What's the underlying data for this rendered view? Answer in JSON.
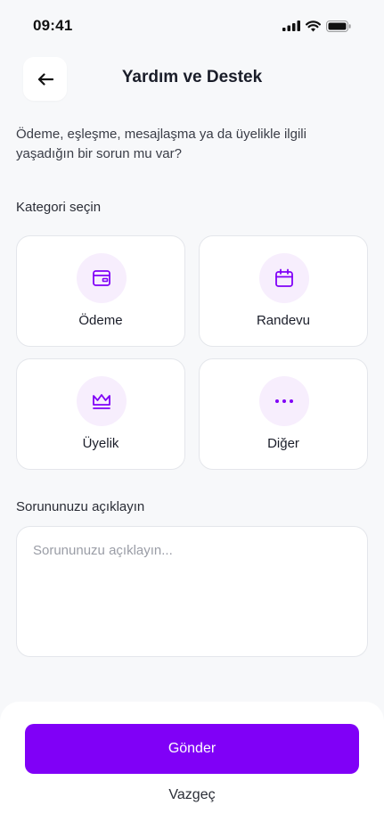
{
  "status_bar": {
    "time": "09:41"
  },
  "header": {
    "title": "Yardım ve Destek",
    "back_icon": "arrow-left-icon"
  },
  "intro": {
    "text": "Ödeme, eşleşme, mesajlaşma ya da üyelikle ilgili yaşadığın bir sorun mu var?"
  },
  "categories": {
    "label": "Kategori seçin",
    "items": [
      {
        "label": "Ödeme",
        "icon": "wallet-icon"
      },
      {
        "label": "Randevu",
        "icon": "calendar-icon"
      },
      {
        "label": "Üyelik",
        "icon": "crown-icon"
      },
      {
        "label": "Diğer",
        "icon": "more-dots-icon"
      }
    ]
  },
  "description": {
    "label": "Sorununuzu açıklayın",
    "placeholder": "Sorununuzu açıklayın...",
    "value": ""
  },
  "actions": {
    "submit_label": "Gönder",
    "cancel_label": "Vazgeç"
  },
  "colors": {
    "accent": "#8000F7",
    "icon_bg": "#F7EEFD",
    "background": "#F7F8FA"
  }
}
